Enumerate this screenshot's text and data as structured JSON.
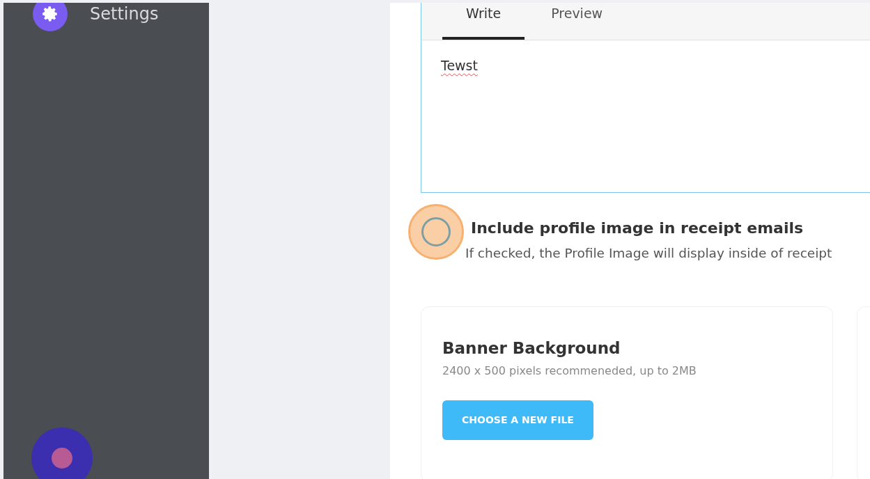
{
  "sidebar": {
    "items": [
      {
        "label": "Settings",
        "kind": "gear"
      }
    ]
  },
  "editor": {
    "tabs": [
      {
        "label": "Write",
        "selected": true
      },
      {
        "label": "Preview",
        "selected": false
      }
    ],
    "value": "Tewst"
  },
  "option": {
    "label": "Include profile image in receipt emails",
    "description": "If checked, the Profile Image will display inside of receipt",
    "checked": false
  },
  "banner_card": {
    "title": "Banner Background",
    "hint": "2400 x 500 pixels recommeneded, up to 2MB",
    "button": "CHOOSE A NEW FILE"
  }
}
